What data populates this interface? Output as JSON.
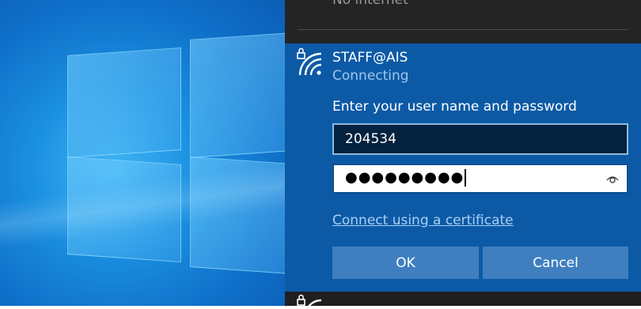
{
  "previous_network": {
    "status": "No internet"
  },
  "selected_network": {
    "name": "STAFF@AIS",
    "status": "Connecting",
    "icon": "secured-wifi-icon",
    "prompt": "Enter your user name and password",
    "username_value": "204534",
    "password_masked": "●●●●●●●●●",
    "reveal_icon": "eye-icon",
    "certificate_link": "Connect using a certificate",
    "ok_label": "OK",
    "cancel_label": "Cancel"
  },
  "next_network": {
    "name": "",
    "icon": "secured-wifi-icon"
  },
  "colors": {
    "panel_bg": "#1f1f1f",
    "selected_bg": "#0c5aa6",
    "button_bg": "#3f7fc0",
    "link": "#a9cff5",
    "status_text": "#9fc7ec"
  }
}
